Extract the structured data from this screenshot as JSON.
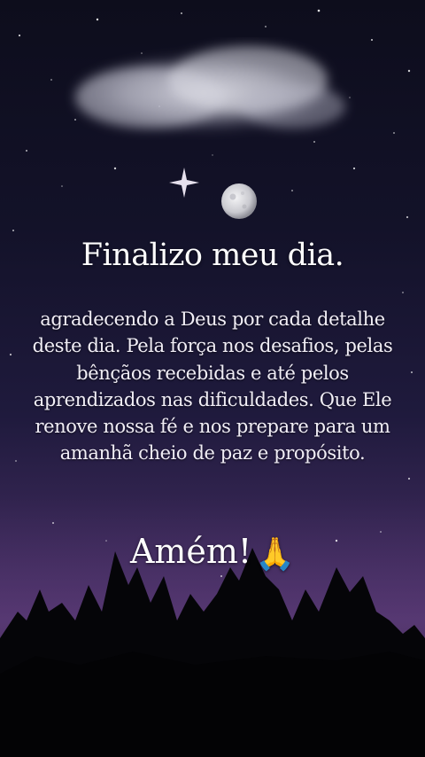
{
  "content": {
    "title": "Finalizo meu dia.",
    "message": "agradecendo a Deus por cada detalhe deste dia. Pela força nos desafios, pelas bênçãos recebidas e até pelos aprendizados nas dificuldades. Que Ele renove nossa fé e nos prepare para um amanhã cheio de paz e propósito.",
    "closing": "Amém!",
    "closing_emoji": "🙏"
  },
  "scene": {
    "icons": [
      "cloud-icon",
      "sparkle-star-icon",
      "moon-icon",
      "tree-silhouette-icon"
    ],
    "colors": {
      "sky_top": "#0d0d1c",
      "sky_mid": "#1f1a3d",
      "sky_horizon": "#4a3066",
      "text": "#ffffff",
      "trees": "#050508"
    }
  }
}
